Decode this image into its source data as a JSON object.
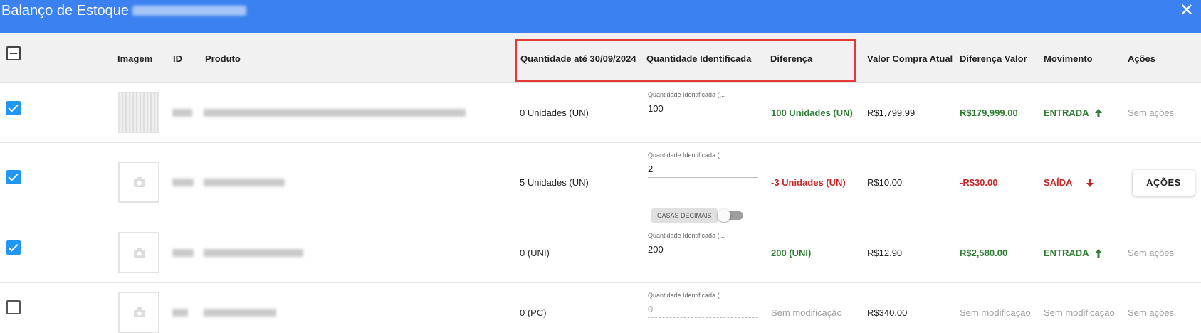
{
  "window": {
    "title": "Balanço de Estoque",
    "close_icon": "✕"
  },
  "headers": {
    "imagem": "Imagem",
    "id": "ID",
    "produto": "Produto",
    "quantidade_ate": "Quantidade até 30/09/2024",
    "quantidade_identificada": "Quantidade Identificada",
    "diferenca": "Diferença",
    "valor_compra": "Valor Compra Atual",
    "diferenca_valor": "Diferença Valor",
    "movimento": "Movimento",
    "acoes": "Ações"
  },
  "qty_label": "Quantidade Identificada (...",
  "decimais_label": "CASAS DECIMAIS",
  "rows": [
    {
      "checked": true,
      "quantidade": "0 Unidades (UN)",
      "identificada": "100",
      "diferenca": "100 Unidades (UN)",
      "valor_compra": "R$1,799.99",
      "diferenca_valor": "R$179,999.00",
      "movimento": "ENTRADA",
      "acoes": "Sem ações"
    },
    {
      "checked": true,
      "quantidade": "5 Unidades (UN)",
      "identificada": "2",
      "diferenca": "-3 Unidades (UN)",
      "valor_compra": "R$10.00",
      "diferenca_valor": "-R$30.00",
      "movimento": "SAÍDA",
      "acoes": "AÇÕES"
    },
    {
      "checked": true,
      "quantidade": "0 (UNI)",
      "identificada": "200",
      "diferenca": "200 (UNI)",
      "valor_compra": "R$12.90",
      "diferenca_valor": "R$2,580.00",
      "movimento": "ENTRADA",
      "acoes": "Sem ações"
    },
    {
      "checked": false,
      "quantidade": "0 (PC)",
      "identificada": "0",
      "diferenca": "Sem modificação",
      "valor_compra": "R$340.00",
      "diferenca_valor": "Sem modificação",
      "movimento": "Sem modificação",
      "acoes": "Sem ações"
    }
  ],
  "colors": {
    "titlebar": "#3b82f0",
    "positive": "#2e7d32",
    "negative": "#c62828",
    "checkbox": "#2196f3",
    "highlight_box": "#e53935"
  }
}
